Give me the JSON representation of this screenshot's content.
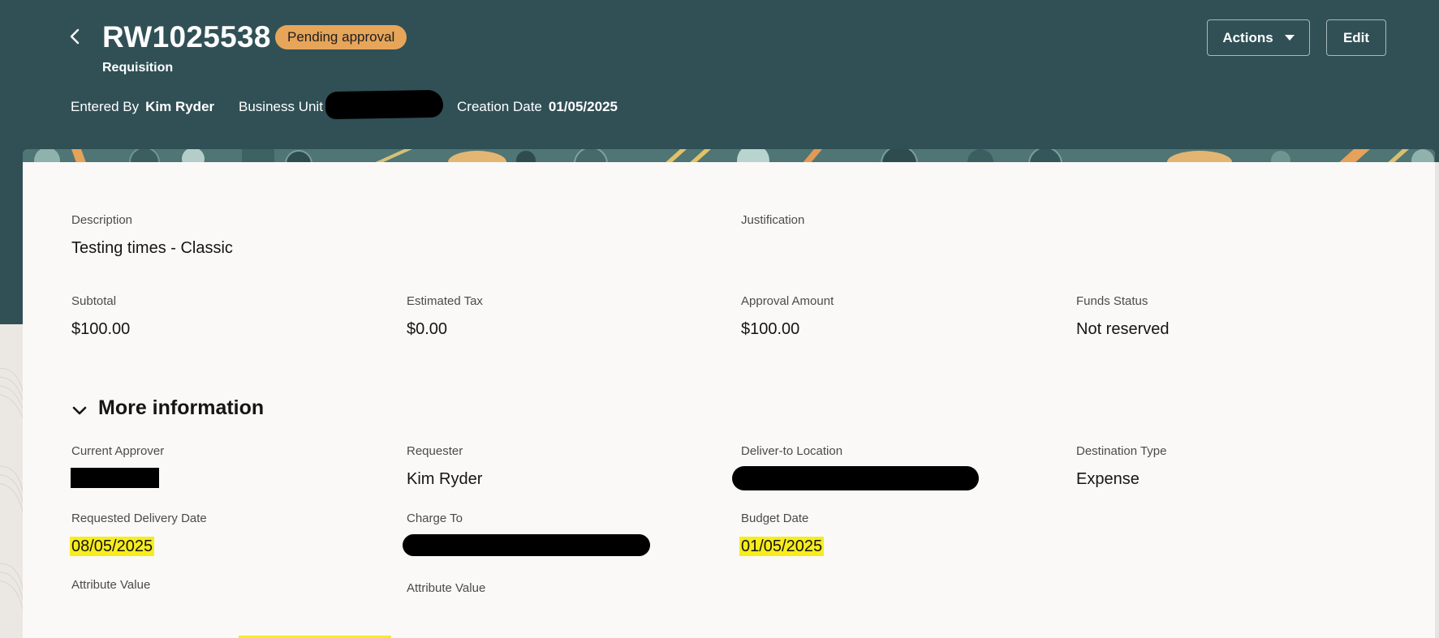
{
  "header": {
    "title": "RW1025538",
    "status": "Pending approval",
    "subtitle": "Requisition",
    "entered_by_label": "Entered By",
    "entered_by_value": "Kim Ryder",
    "business_unit_label": "Business Unit",
    "creation_date_label": "Creation Date",
    "creation_date_value": "01/05/2025",
    "actions_label": "Actions",
    "edit_label": "Edit"
  },
  "summary": {
    "description_label": "Description",
    "description_value": "Testing times - Classic",
    "justification_label": "Justification",
    "subtotal_label": "Subtotal",
    "subtotal_value": "$100.00",
    "tax_label": "Estimated Tax",
    "tax_value": "$0.00",
    "approval_amount_label": "Approval Amount",
    "approval_amount_value": "$100.00",
    "funds_status_label": "Funds Status",
    "funds_status_value": "Not reserved"
  },
  "more_info": {
    "title": "More information",
    "current_approver_label": "Current Approver",
    "requester_label": "Requester",
    "requester_value": "Kim Ryder",
    "deliver_to_label": "Deliver-to Location",
    "destination_type_label": "Destination Type",
    "destination_type_value": "Expense",
    "requested_delivery_label": "Requested Delivery Date",
    "requested_delivery_value": "08/05/2025",
    "charge_to_label": "Charge To",
    "budget_date_label": "Budget Date",
    "budget_date_value": "01/05/2025",
    "attribute_label_1": "Attribute Value",
    "attribute_label_2": "Attribute Value"
  },
  "colors": {
    "header_bg": "#305056",
    "badge_bg": "#e7a55a",
    "highlight": "#f7ec1d",
    "card_bg": "#faf9f8"
  }
}
